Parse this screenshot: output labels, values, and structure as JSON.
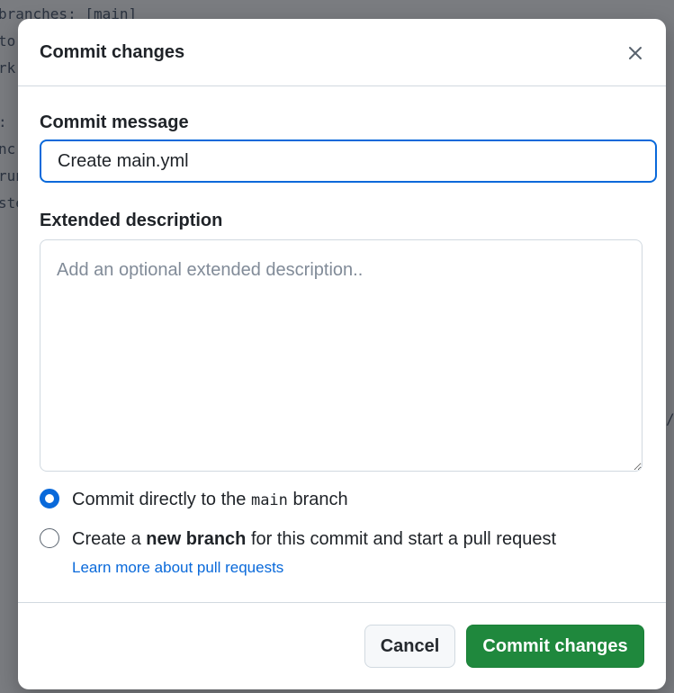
{
  "backdrop": {
    "lines": [
      "branches: [main]",
      "to",
      "rk",
      ":",
      "nc",
      "run",
      "ste",
      "/"
    ]
  },
  "dialog": {
    "title": "Commit changes",
    "close_icon": "close-icon",
    "commit_message": {
      "label": "Commit message",
      "value": "Create main.yml"
    },
    "extended_description": {
      "label": "Extended description",
      "placeholder": "Add an optional extended description.."
    },
    "options": {
      "direct": {
        "prefix": "Commit directly to the ",
        "branch": "main",
        "suffix": " branch",
        "selected": true
      },
      "new_branch": {
        "prefix": "Create a ",
        "bold": "new branch",
        "suffix": " for this commit and start a pull request",
        "selected": false
      }
    },
    "learn_more_link": "Learn more about pull requests",
    "buttons": {
      "cancel": "Cancel",
      "commit": "Commit changes"
    }
  },
  "colors": {
    "accent": "#0969da",
    "primary_button": "#1f883d",
    "overlay": "#7a7c80"
  }
}
